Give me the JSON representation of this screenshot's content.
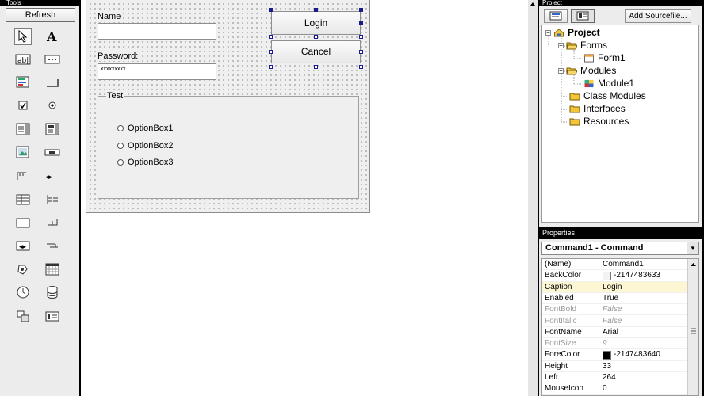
{
  "tools": {
    "title": "Tools",
    "refresh_label": "Refresh",
    "items": [
      "pointer",
      "label",
      "textbox",
      "frame",
      "command-button",
      "checkbox",
      "option-button",
      "combo",
      "list",
      "picture",
      "hscroll",
      "vscroll",
      "timer",
      "drive-list",
      "dir-list",
      "file-list",
      "shape",
      "line",
      "image",
      "data",
      "ole",
      "animation",
      "clock",
      "database",
      "misc",
      "grid"
    ]
  },
  "form": {
    "name_label": "Name",
    "name_value": "",
    "password_label": "Password:",
    "password_value": "xxxxxxxxx",
    "login_label": "Login",
    "cancel_label": "Cancel",
    "frame_title": "Test",
    "options": [
      "OptionBox1",
      "OptionBox2",
      "OptionBox3"
    ]
  },
  "project": {
    "title": "Project",
    "add_label": "Add Sourcefile...",
    "tree": [
      {
        "label": "Project",
        "level": 0,
        "bold": true,
        "pm": "-"
      },
      {
        "label": "Forms",
        "level": 1,
        "pm": "-"
      },
      {
        "label": "Form1",
        "level": 2,
        "icon": "form"
      },
      {
        "label": "Modules",
        "level": 1,
        "pm": "-"
      },
      {
        "label": "Module1",
        "level": 2,
        "icon": "module"
      },
      {
        "label": "Class Modules",
        "level": 1
      },
      {
        "label": "Interfaces",
        "level": 1
      },
      {
        "label": "Resources",
        "level": 1
      }
    ]
  },
  "properties": {
    "title": "Properties",
    "object": "Command1 - Command",
    "rows": [
      {
        "k": "(Name)",
        "v": "Command1"
      },
      {
        "k": "BackColor",
        "v": "-2147483633",
        "swatch": "#f2f2f2"
      },
      {
        "k": "Caption",
        "v": "Login",
        "hl": true
      },
      {
        "k": "Enabled",
        "v": "True"
      },
      {
        "k": "FontBold",
        "v": "False",
        "dis": true
      },
      {
        "k": "FontItalic",
        "v": "False",
        "dis": true
      },
      {
        "k": "FontName",
        "v": "Arial"
      },
      {
        "k": "FontSize",
        "v": "9",
        "dis": true
      },
      {
        "k": "ForeColor",
        "v": "-2147483640",
        "swatch": "#000000"
      },
      {
        "k": "Height",
        "v": "33"
      },
      {
        "k": "Left",
        "v": "264"
      },
      {
        "k": "MouseIcon",
        "v": "0"
      }
    ]
  }
}
